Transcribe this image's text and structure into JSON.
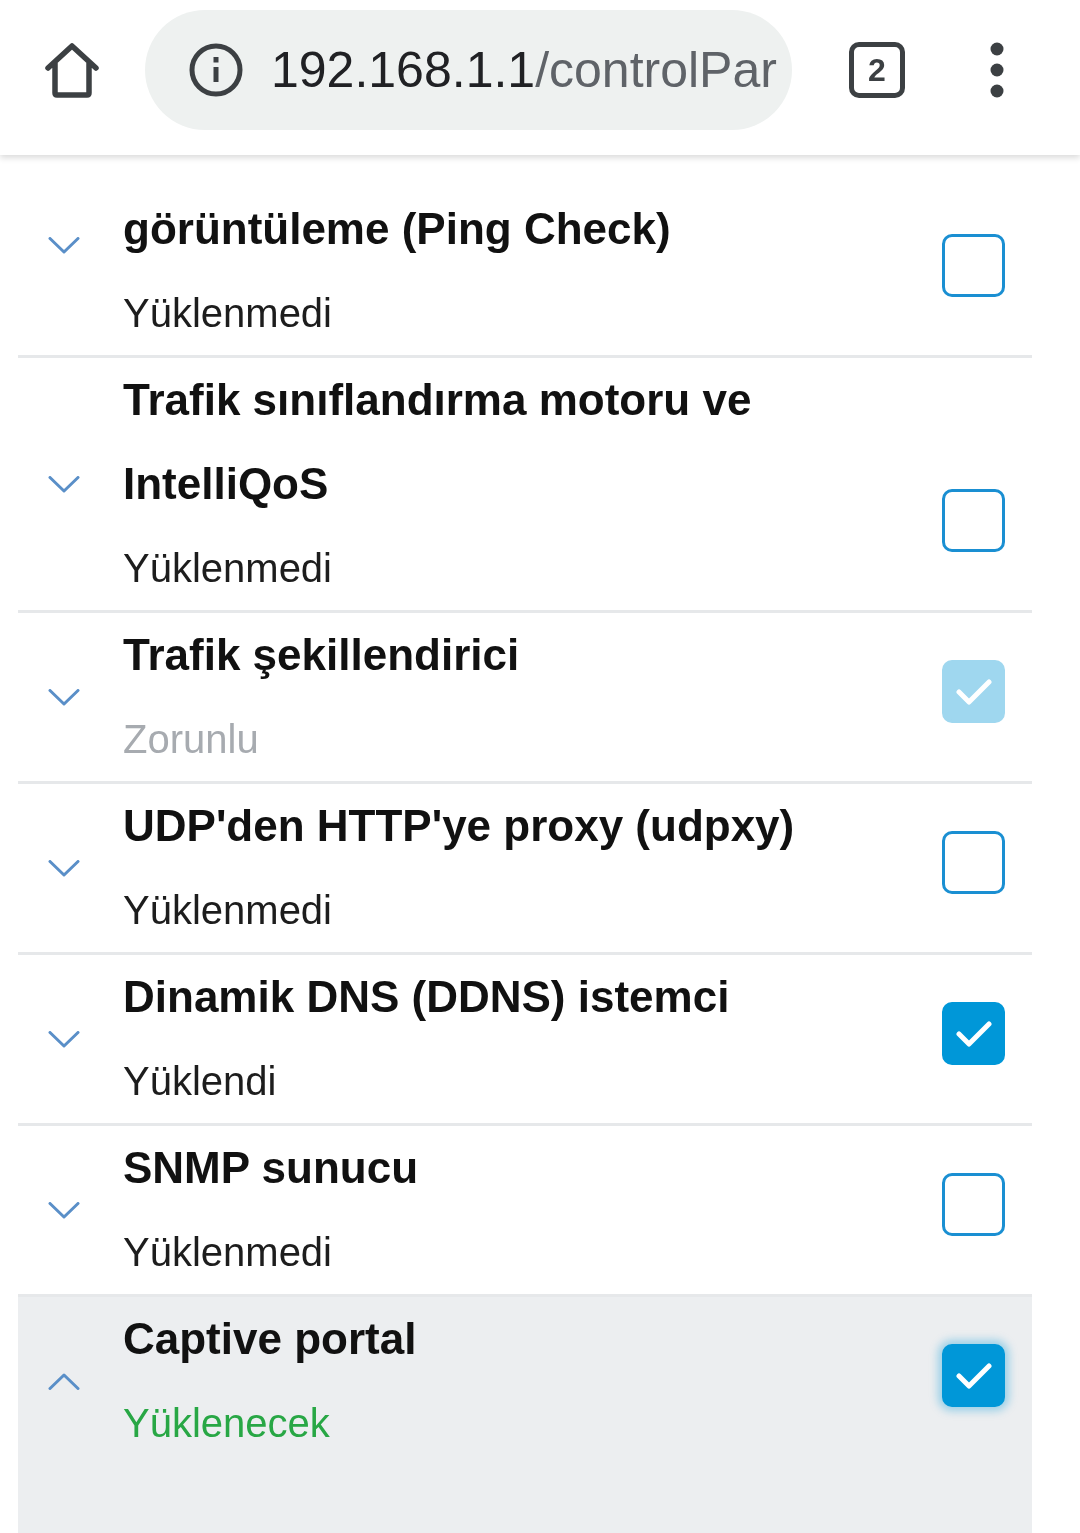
{
  "browser_bar": {
    "url_host": "192.168.1.1",
    "url_path": "/controlPar",
    "tab_count": "2"
  },
  "packages": [
    {
      "kind": "normal",
      "title": "görüntüleme (Ping Check)",
      "status": "Yüklenmedi",
      "checked": false,
      "disabled": false,
      "focused": false,
      "expanded": false
    },
    {
      "kind": "normal",
      "title": "Trafik sınıflandırma motoru ve IntelliQoS",
      "status": "Yüklenmedi",
      "checked": false,
      "disabled": false,
      "focused": false,
      "expanded": false
    },
    {
      "kind": "muted",
      "title": "Trafik şekillendirici",
      "status": "Zorunlu",
      "checked": true,
      "disabled": true,
      "focused": false,
      "expanded": false
    },
    {
      "kind": "normal",
      "title": "UDP'den HTTP'ye proxy (udpxy)",
      "status": "Yüklenmedi",
      "checked": false,
      "disabled": false,
      "focused": false,
      "expanded": false
    },
    {
      "kind": "normal",
      "title": "Dinamik DNS (DDNS) istemci",
      "status": "Yüklendi",
      "checked": true,
      "disabled": false,
      "focused": false,
      "expanded": false
    },
    {
      "kind": "normal",
      "title": "SNMP sunucu",
      "status": "Yüklenmedi",
      "checked": false,
      "disabled": false,
      "focused": false,
      "expanded": false
    },
    {
      "kind": "pending",
      "title": "Captive portal",
      "status": "Yüklenecek",
      "checked": true,
      "disabled": false,
      "focused": true,
      "expanded": true
    }
  ]
}
